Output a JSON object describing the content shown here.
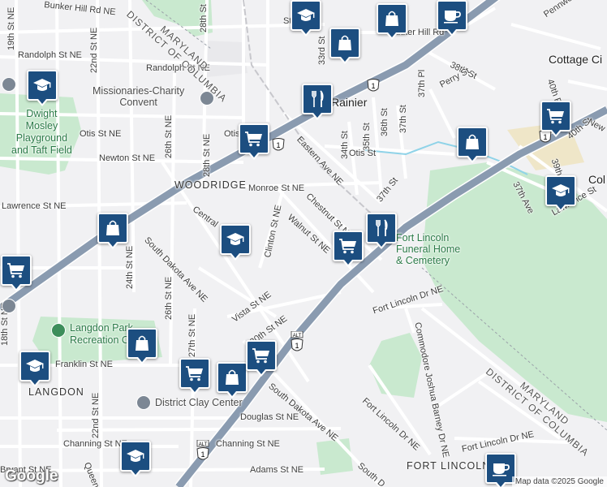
{
  "attribution": "Map data ©2025 Google",
  "logo_text": "Google",
  "streets": [
    {
      "id": "bunker-hill-rd-ne-w",
      "text": "Bunker Hill Rd NE"
    },
    {
      "id": "19th-st-ne",
      "text": "19th St NE"
    },
    {
      "id": "22nd-st-ne-top",
      "text": "22nd St NE"
    },
    {
      "id": "28th-st-top",
      "text": "28th St"
    },
    {
      "id": "randolph-st-ne-w",
      "text": "Randolph St NE"
    },
    {
      "id": "randolph-st-ne-c",
      "text": "Randolph St NE"
    },
    {
      "id": "26th-st-ne-top",
      "text": "26th St NE"
    },
    {
      "id": "28th-st-ne-mid",
      "text": "28th St NE"
    },
    {
      "id": "otis-st-ne-w",
      "text": "Otis St NE"
    },
    {
      "id": "otis-st-c",
      "text": "Otis"
    },
    {
      "id": "newton-st-ne",
      "text": "Newton St NE"
    },
    {
      "id": "monroe-st-ne",
      "text": "Monroe St NE"
    },
    {
      "id": "lawrence-st-ne-w",
      "text": "Lawrence St NE"
    },
    {
      "id": "central-ave",
      "text": "Central"
    },
    {
      "id": "clinton-st-ne",
      "text": "Clinton St NE"
    },
    {
      "id": "walnut-st-ne",
      "text": "Walnut St NE"
    },
    {
      "id": "chestnut-st-ne",
      "text": "Chestnut St NE"
    },
    {
      "id": "eastern-ave-ne",
      "text": "Eastern Ave NE"
    },
    {
      "id": "south-dakota-ave-ne-n",
      "text": "South Dakota Ave NE"
    },
    {
      "id": "24th-st-ne",
      "text": "24th St NE"
    },
    {
      "id": "26th-st-ne-low",
      "text": "26th St NE"
    },
    {
      "id": "27th-st-ne",
      "text": "27th St NE"
    },
    {
      "id": "vista-st-ne",
      "text": "Vista St NE"
    },
    {
      "id": "30th-st-ne",
      "text": "30th St NE"
    },
    {
      "id": "18th-st-ne",
      "text": "18th St NE"
    },
    {
      "id": "franklin-st-ne",
      "text": "Franklin St NE"
    },
    {
      "id": "22nd-st-ne-low",
      "text": "22nd St NE"
    },
    {
      "id": "douglas-st-ne",
      "text": "Douglas St NE"
    },
    {
      "id": "channing-st-ne-w",
      "text": "Channing St NE"
    },
    {
      "id": "channing-st-ne-c",
      "text": "Channing St NE"
    },
    {
      "id": "bryant-st-ne",
      "text": "Bryant St NE"
    },
    {
      "id": "queens",
      "text": "Queens"
    },
    {
      "id": "adams-st-ne",
      "text": "Adams St NE"
    },
    {
      "id": "south-dakota-ave-ne-s",
      "text": "South Dakota Ave NE"
    },
    {
      "id": "south-d",
      "text": "South D"
    },
    {
      "id": "bunker-hill-rd-e",
      "text": "Bunker Hill Rd"
    },
    {
      "id": "33rd-st",
      "text": "33rd St"
    },
    {
      "id": "34th-st",
      "text": "34th St"
    },
    {
      "id": "35th-st",
      "text": "35th St"
    },
    {
      "id": "36th-st",
      "text": "36th St"
    },
    {
      "id": "37th-st",
      "text": "37th St"
    },
    {
      "id": "37th-st-2",
      "text": "37th St"
    },
    {
      "id": "37th-pl",
      "text": "37th Pl"
    },
    {
      "id": "38th-st",
      "text": "38th St"
    },
    {
      "id": "perry-st",
      "text": "Perry St"
    },
    {
      "id": "otis-st-e",
      "text": "Otis St"
    },
    {
      "id": "fort-lincoln-dr-ne-n",
      "text": "Fort Lincoln Dr NE"
    },
    {
      "id": "fort-lincoln-dr-ne-s",
      "text": "Fort Lincoln Dr NE"
    },
    {
      "id": "fort-lincoln-dr-ne-se",
      "text": "Fort Lincoln Dr NE"
    },
    {
      "id": "commodore-joshua-barney-dr-ne",
      "text": "Commodore Joshua Barney Dr NE"
    },
    {
      "id": "40th-pl",
      "text": "40th Pl"
    },
    {
      "id": "40th-st",
      "text": "40th St"
    },
    {
      "id": "39th-st",
      "text": "39th"
    },
    {
      "id": "37th-ave",
      "text": "37th Ave"
    },
    {
      "id": "lawrence-st-e",
      "text": "Lawrence St"
    },
    {
      "id": "new",
      "text": "New"
    },
    {
      "id": "pennwood",
      "text": "Pennwo"
    },
    {
      "id": "st-top",
      "text": "St"
    }
  ],
  "places": [
    {
      "id": "missionaries-charity-convent",
      "text": "Missionaries-Charity\nConvent"
    },
    {
      "id": "dwight-mosley-playground",
      "text": "Dwight\nMosley\nPlayground\nand Taft Field"
    },
    {
      "id": "langdon-park-rec",
      "text": "Langdon Park\nRecreation Center"
    },
    {
      "id": "district-clay-center",
      "text": "District Clay Center"
    },
    {
      "id": "fort-lincoln-funeral-home",
      "text": "Fort Lincoln\nFuneral Home\n& Cemetery"
    }
  ],
  "neighborhoods": [
    {
      "id": "woodridge",
      "text": "WOODRIDGE"
    },
    {
      "id": "langdon",
      "text": "LANGDON"
    },
    {
      "id": "fort-lincoln",
      "text": "FORT LINCOLN"
    }
  ],
  "cities": [
    {
      "id": "mount-rainier",
      "text": "Rainier"
    },
    {
      "id": "cottage-city",
      "text": "Cottage Ci"
    },
    {
      "id": "colmar-manor",
      "text": "Col"
    }
  ],
  "state_labels": [
    {
      "id": "maryland-dc-top",
      "text": "MARYLAND\nDISTRICT OF COLUMBIA"
    },
    {
      "id": "maryland-dc-se",
      "text": "MARYLAND\nDISTRICT OF COLUMBIA"
    }
  ],
  "shields": [
    {
      "id": "us1-north",
      "text": "1"
    },
    {
      "id": "us1-mid",
      "text": "1"
    },
    {
      "id": "us1-east",
      "text": "1"
    },
    {
      "id": "us1-alt",
      "text": "1",
      "alt": "ALT"
    },
    {
      "id": "us1-alt-s",
      "text": "1",
      "alt": "ALT"
    }
  ],
  "markers": [
    {
      "id": "marker-school-top",
      "icon": "school"
    },
    {
      "id": "marker-shop-top",
      "icon": "shopping-bag"
    },
    {
      "id": "marker-cafe-top",
      "icon": "coffee"
    },
    {
      "id": "marker-stack-top",
      "icon": "shopping-bag"
    },
    {
      "id": "marker-restaurant-rainier",
      "icon": "restaurant"
    },
    {
      "id": "marker-cart-otis",
      "icon": "shopping-cart"
    },
    {
      "id": "marker-school-dwight",
      "icon": "school"
    },
    {
      "id": "marker-cart-east",
      "icon": "shopping-cart"
    },
    {
      "id": "marker-shop-otis",
      "icon": "shopping-bag"
    },
    {
      "id": "marker-school-east",
      "icon": "school"
    },
    {
      "id": "marker-shop-lawrence",
      "icon": "shopping-bag"
    },
    {
      "id": "marker-school-central",
      "icon": "school"
    },
    {
      "id": "marker-restaurant-chestnut",
      "icon": "restaurant"
    },
    {
      "id": "marker-cart-walnut",
      "icon": "shopping-cart"
    },
    {
      "id": "marker-cart-west",
      "icon": "shopping-cart"
    },
    {
      "id": "marker-shop-langdon",
      "icon": "shopping-bag"
    },
    {
      "id": "marker-school-franklin",
      "icon": "school"
    },
    {
      "id": "marker-cart-south",
      "icon": "shopping-cart"
    },
    {
      "id": "marker-shop-south",
      "icon": "shopping-bag"
    },
    {
      "id": "marker-cart-30th",
      "icon": "shopping-cart"
    },
    {
      "id": "marker-school-queens",
      "icon": "school"
    },
    {
      "id": "marker-cafe-fortlincoln",
      "icon": "coffee"
    }
  ]
}
